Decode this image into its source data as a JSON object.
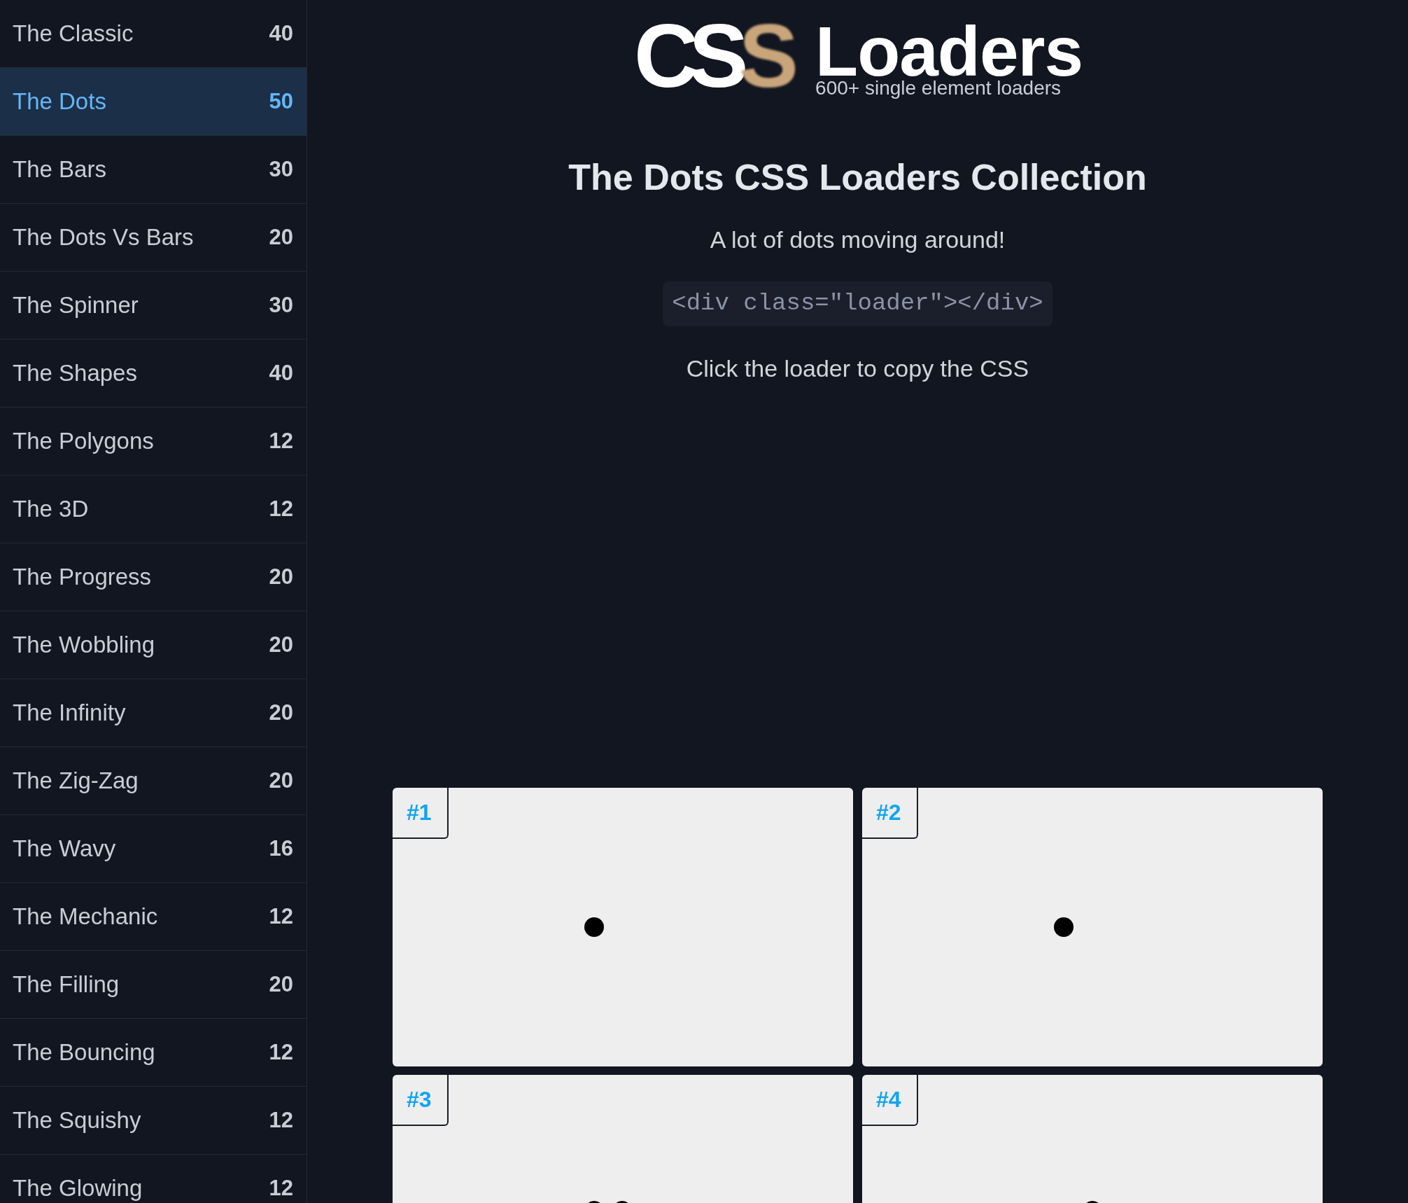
{
  "sidebar": {
    "items": [
      {
        "label": "The Classic",
        "count": "40",
        "selected": false
      },
      {
        "label": "The Dots",
        "count": "50",
        "selected": true
      },
      {
        "label": "The Bars",
        "count": "30",
        "selected": false
      },
      {
        "label": "The Dots Vs Bars",
        "count": "20",
        "selected": false
      },
      {
        "label": "The Spinner",
        "count": "30",
        "selected": false
      },
      {
        "label": "The Shapes",
        "count": "40",
        "selected": false
      },
      {
        "label": "The Polygons",
        "count": "12",
        "selected": false
      },
      {
        "label": "The 3D",
        "count": "12",
        "selected": false
      },
      {
        "label": "The Progress",
        "count": "20",
        "selected": false
      },
      {
        "label": "The Wobbling",
        "count": "20",
        "selected": false
      },
      {
        "label": "The Infinity",
        "count": "20",
        "selected": false
      },
      {
        "label": "The Zig-Zag",
        "count": "20",
        "selected": false
      },
      {
        "label": "The Wavy",
        "count": "16",
        "selected": false
      },
      {
        "label": "The Mechanic",
        "count": "12",
        "selected": false
      },
      {
        "label": "The Filling",
        "count": "20",
        "selected": false
      },
      {
        "label": "The Bouncing",
        "count": "12",
        "selected": false
      },
      {
        "label": "The Squishy",
        "count": "12",
        "selected": false
      },
      {
        "label": "The Glowing",
        "count": "12",
        "selected": false
      }
    ]
  },
  "logo": {
    "mark": "CS",
    "mark_accent": "S",
    "wordmark": "Loaders",
    "tagline": "600+ single element loaders"
  },
  "heading": "The Dots CSS Loaders Collection",
  "description": "A lot of dots moving around!",
  "code_snippet": "<div class=\"loader\"></div>",
  "hint": "Click the loader to copy the CSS",
  "cards": [
    {
      "label": "#1",
      "kind": "single"
    },
    {
      "label": "#2",
      "kind": "single"
    },
    {
      "label": "#3",
      "kind": "pair"
    },
    {
      "label": "#4",
      "kind": "centered"
    }
  ]
}
